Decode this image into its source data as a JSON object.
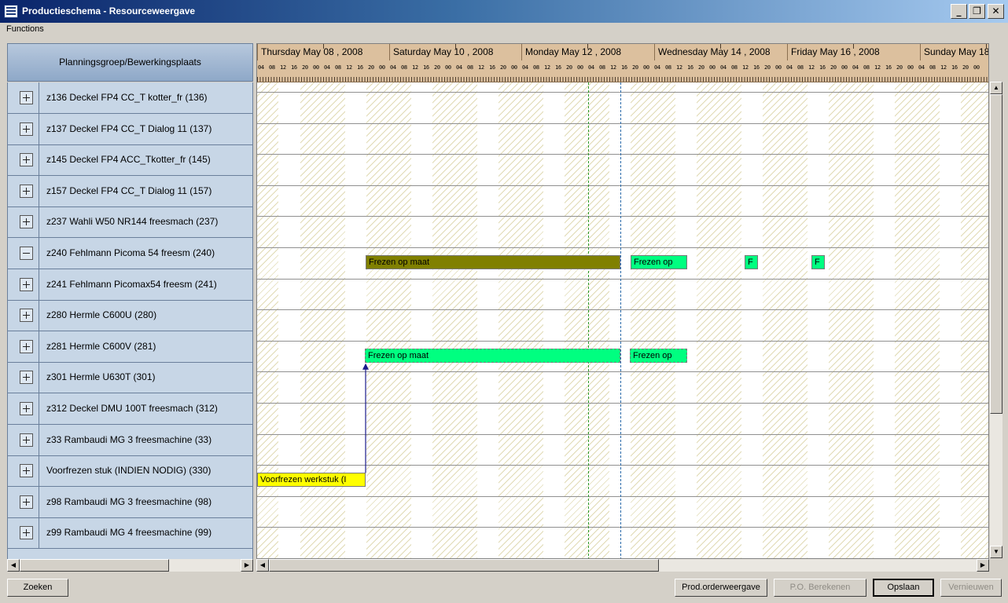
{
  "window": {
    "title": "Productieschema - Resourceweergave",
    "buttons": {
      "minimize": "_",
      "restore": "❐",
      "close": "✕"
    }
  },
  "menu": {
    "functions": "Functions"
  },
  "left_panel": {
    "header": "Planningsgroep/Bewerkingsplaats",
    "rows": [
      {
        "label": "z136 Deckel FP4 CC_T kotter_fr  (136)",
        "expander": "plus"
      },
      {
        "label": "z137 Deckel FP4 CC_T Dialog 11  (137)",
        "expander": "plus"
      },
      {
        "label": "z145 Deckel FP4 ACC_Tkotter_fr  (145)",
        "expander": "plus"
      },
      {
        "label": "z157 Deckel FP4 CC_T Dialog 11  (157)",
        "expander": "plus"
      },
      {
        "label": "z237 Wahli W50 NR144 freesmach  (237)",
        "expander": "plus"
      },
      {
        "label": "z240 Fehlmann Picoma 54 freesm  (240)",
        "expander": "minus"
      },
      {
        "label": "z241 Fehlmann Picomax54 freesm  (241)",
        "expander": "plus"
      },
      {
        "label": "z280 Hermle C600U  (280)",
        "expander": "plus"
      },
      {
        "label": "z281 Hermle C600V  (281)",
        "expander": "plus"
      },
      {
        "label": "z301 Hermle U630T  (301)",
        "expander": "plus"
      },
      {
        "label": "z312 Deckel DMU 100T freesmach  (312)",
        "expander": "plus"
      },
      {
        "label": "z33 Rambaudi MG 3 freesmachine  (33)",
        "expander": "plus"
      },
      {
        "label": "Voorfrezen stuk  (INDIEN NODIG)  (330)",
        "expander": "plus"
      },
      {
        "label": "z98 Rambaudi MG 3 freesmachine  (98)",
        "expander": "plus"
      },
      {
        "label": "z99 Rambaudi MG 4 freesmachine  (99)",
        "expander": "plus"
      }
    ]
  },
  "gantt": {
    "days": [
      "Thursday May 08 , 2008",
      "Saturday May 10 , 2008",
      "Monday May 12 , 2008",
      "Wednesday May 14 , 2008",
      "Friday May 16 , 2008",
      "Sunday May 18"
    ],
    "hour_labels": [
      "04",
      "08",
      "12",
      "16",
      "20",
      "00"
    ],
    "bars": [
      {
        "label": "Frezen op maat",
        "row": 5,
        "color": "#808000"
      },
      {
        "label": "Frezen op",
        "row": 5,
        "color": "#00ff80"
      },
      {
        "label": "F",
        "row": 5,
        "color": "#00ff80"
      },
      {
        "label": "F",
        "row": 5,
        "color": "#00ff80"
      },
      {
        "label": "Frezen op maat",
        "row": 8,
        "color": "#00ff80"
      },
      {
        "label": "Frezen op",
        "row": 8,
        "color": "#00ff80"
      },
      {
        "label": "Voorfrezen werkstuk (I",
        "row": 12,
        "color": "#ffff00"
      }
    ]
  },
  "buttons": {
    "zoeken": "Zoeken",
    "prod_orderweergave": "Prod.orderweergave",
    "po_berekenen": "P.O. Berekenen",
    "opslaan": "Opslaan",
    "vernieuwen": "Vernieuwen"
  },
  "scrollbar_arrows": {
    "up": "▲",
    "down": "▼",
    "left": "◀",
    "right": "▶"
  }
}
